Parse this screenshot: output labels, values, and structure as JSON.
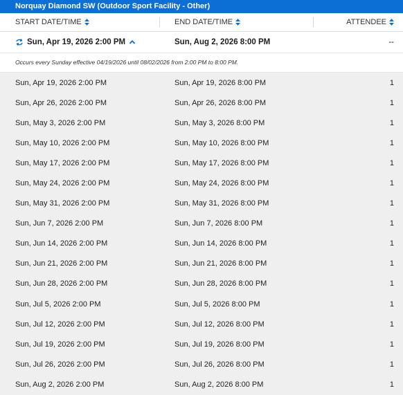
{
  "title": "Norquay Diamond SW (Outdoor Sport Facility - Other)",
  "columns": {
    "start": "START DATE/TIME",
    "end": "END DATE/TIME",
    "attendee": "ATTENDEE"
  },
  "group": {
    "start": "Sun, Apr 19, 2026 2:00 PM",
    "end": "Sun, Aug 2, 2026 8:00 PM",
    "attendee": "--",
    "note": "Occurs every Sunday effective 04/19/2026 until 08/02/2026 from 2:00 PM to 8:00 PM."
  },
  "occurrences": [
    {
      "start": "Sun, Apr 19, 2026 2:00 PM",
      "end": "Sun, Apr 19, 2026 8:00 PM",
      "attendee": "1"
    },
    {
      "start": "Sun, Apr 26, 2026 2:00 PM",
      "end": "Sun, Apr 26, 2026 8:00 PM",
      "attendee": "1"
    },
    {
      "start": "Sun, May 3, 2026 2:00 PM",
      "end": "Sun, May 3, 2026 8:00 PM",
      "attendee": "1"
    },
    {
      "start": "Sun, May 10, 2026 2:00 PM",
      "end": "Sun, May 10, 2026 8:00 PM",
      "attendee": "1"
    },
    {
      "start": "Sun, May 17, 2026 2:00 PM",
      "end": "Sun, May 17, 2026 8:00 PM",
      "attendee": "1"
    },
    {
      "start": "Sun, May 24, 2026 2:00 PM",
      "end": "Sun, May 24, 2026 8:00 PM",
      "attendee": "1"
    },
    {
      "start": "Sun, May 31, 2026 2:00 PM",
      "end": "Sun, May 31, 2026 8:00 PM",
      "attendee": "1"
    },
    {
      "start": "Sun, Jun 7, 2026 2:00 PM",
      "end": "Sun, Jun 7, 2026 8:00 PM",
      "attendee": "1"
    },
    {
      "start": "Sun, Jun 14, 2026 2:00 PM",
      "end": "Sun, Jun 14, 2026 8:00 PM",
      "attendee": "1"
    },
    {
      "start": "Sun, Jun 21, 2026 2:00 PM",
      "end": "Sun, Jun 21, 2026 8:00 PM",
      "attendee": "1"
    },
    {
      "start": "Sun, Jun 28, 2026 2:00 PM",
      "end": "Sun, Jun 28, 2026 8:00 PM",
      "attendee": "1"
    },
    {
      "start": "Sun, Jul 5, 2026 2:00 PM",
      "end": "Sun, Jul 5, 2026 8:00 PM",
      "attendee": "1"
    },
    {
      "start": "Sun, Jul 12, 2026 2:00 PM",
      "end": "Sun, Jul 12, 2026 8:00 PM",
      "attendee": "1"
    },
    {
      "start": "Sun, Jul 19, 2026 2:00 PM",
      "end": "Sun, Jul 19, 2026 8:00 PM",
      "attendee": "1"
    },
    {
      "start": "Sun, Jul 26, 2026 2:00 PM",
      "end": "Sun, Jul 26, 2026 8:00 PM",
      "attendee": "1"
    },
    {
      "start": "Sun, Aug 2, 2026 2:00 PM",
      "end": "Sun, Aug 2, 2026 8:00 PM",
      "attendee": "1"
    }
  ],
  "icons": {
    "sort": "sort-icon",
    "repeat": "repeat-icon",
    "collapse": "chevron-up-icon"
  },
  "colors": {
    "accent": "#0c6fd6",
    "row_background": "#efefef"
  }
}
